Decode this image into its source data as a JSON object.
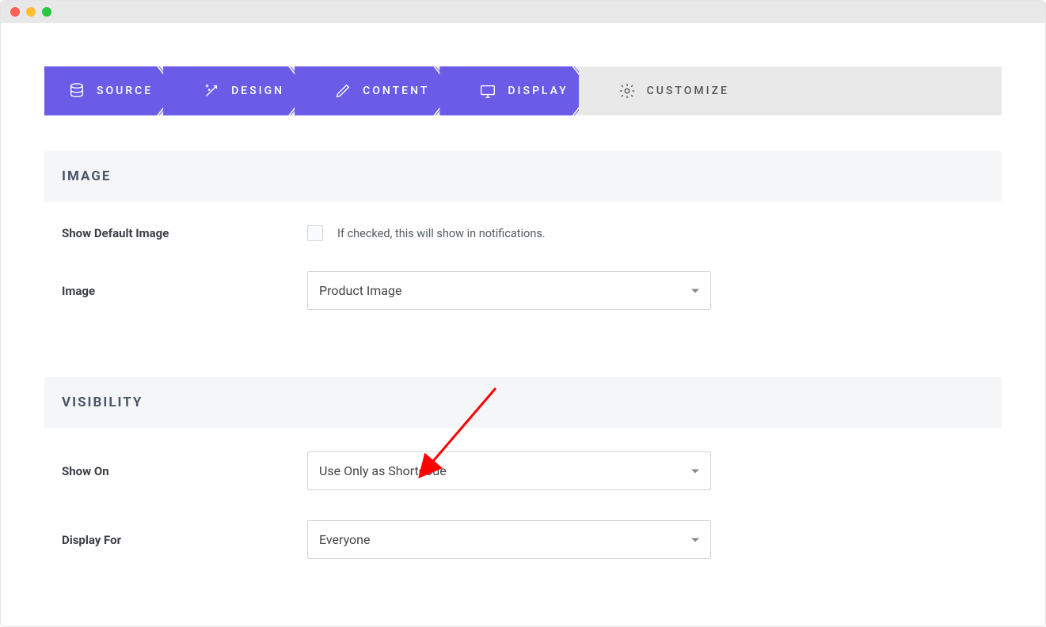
{
  "wizard": {
    "steps": [
      {
        "label": "SOURCE",
        "icon": "database-icon",
        "active": true
      },
      {
        "label": "DESIGN",
        "icon": "wand-icon",
        "active": true
      },
      {
        "label": "CONTENT",
        "icon": "pencil-icon",
        "active": true
      },
      {
        "label": "DISPLAY",
        "icon": "monitor-icon",
        "active": true
      },
      {
        "label": "CUSTOMIZE",
        "icon": "gear-icon",
        "active": false
      }
    ]
  },
  "sections": {
    "image": {
      "title": "IMAGE",
      "show_default_label": "Show Default Image",
      "show_default_help": "If checked, this will show in notifications.",
      "image_label": "Image",
      "image_value": "Product Image"
    },
    "visibility": {
      "title": "VISIBILITY",
      "show_on_label": "Show On",
      "show_on_value": "Use Only as Shortcode",
      "display_for_label": "Display For",
      "display_for_value": "Everyone"
    }
  }
}
